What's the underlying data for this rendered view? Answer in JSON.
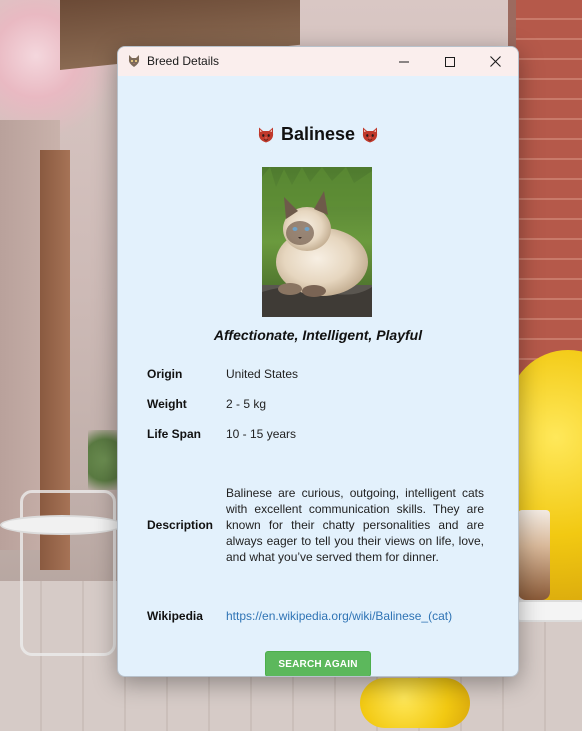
{
  "window": {
    "title": "Breed Details",
    "app_icon": "cat-face-icon"
  },
  "breed": {
    "name": "Balinese",
    "title_icon": "cat-face-emoji-icon",
    "temperament": "Affectionate, Intelligent, Playful",
    "photo_alt": "Balinese cat photo"
  },
  "details": {
    "origin_label": "Origin",
    "origin_value": "United States",
    "weight_label": "Weight",
    "weight_value": "2 - 5 kg",
    "lifespan_label": "Life Span",
    "lifespan_value": "10 - 15 years",
    "description_label": "Description",
    "description_value": "Balinese are curious, outgoing, intelligent cats with excellent communication skills. They are known for their chatty personalities and are always eager to tell you their views on life, love, and what you’ve served them for dinner.",
    "wikipedia_label": "Wikipedia",
    "wikipedia_url": "https://en.wikipedia.org/wiki/Balinese_(cat)"
  },
  "actions": {
    "search_again_label": "SEARCH AGAIN"
  },
  "colors": {
    "window_bg": "#e3f1fc",
    "titlebar_bg": "#faeeed",
    "link": "#2f74b5",
    "button_green": "#5cb85c"
  }
}
